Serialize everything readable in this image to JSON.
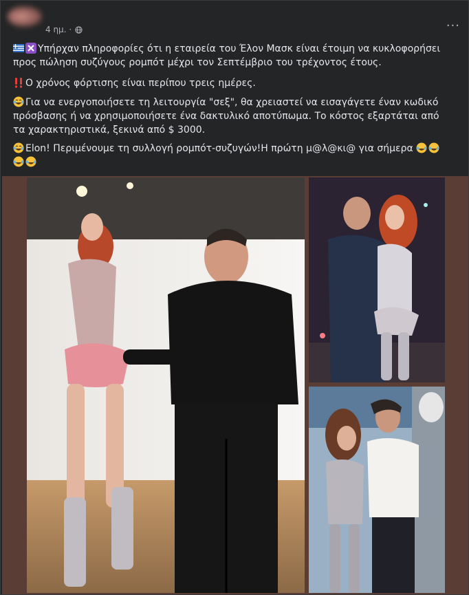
{
  "post": {
    "time": "4 ημ. ·",
    "more": "···",
    "line1": "Υπήρχαν πληροφορίες ότι η εταιρεία του Έλον Μασκ είναι έτοιμη να κυκλοφορήσει προς πώληση συζύγους ρομπότ μέχρι τον Σεπτέμβριο του τρέχοντος έτους.",
    "line2": "Ο χρόνος φόρτισης είναι περίπου τρεις ημέρες.",
    "line3": "Για να ενεργοποιήσετε τη λειτουργία \"σεξ\", θα χρειαστεί να εισαγάγετε έναν κωδικό πρόσβασης ή να χρησιμοποιήσετε ένα δακτυλικό αποτύπωμα. Το κόστος εξαρτάται από τα χαρακτηριστικά, ξεκινά από $ 3000.",
    "line4": "Elon! Περιμένουμε τη συλλογή ρομπότ-συζυγών!Η πρώτη μ@λ@κι@ για σήμερα"
  },
  "icons": {
    "flag": "greek-flag-icon",
    "cross": "cross-mark-icon",
    "alert": "double-exclamation-icon",
    "laugh": "tears-of-joy-icon",
    "globe": "globe-icon"
  },
  "colors": {
    "card_bg": "#242526",
    "text": "#e4e6eb",
    "secondary": "#b0b3b8",
    "photo_frame": "#5a3d35"
  }
}
